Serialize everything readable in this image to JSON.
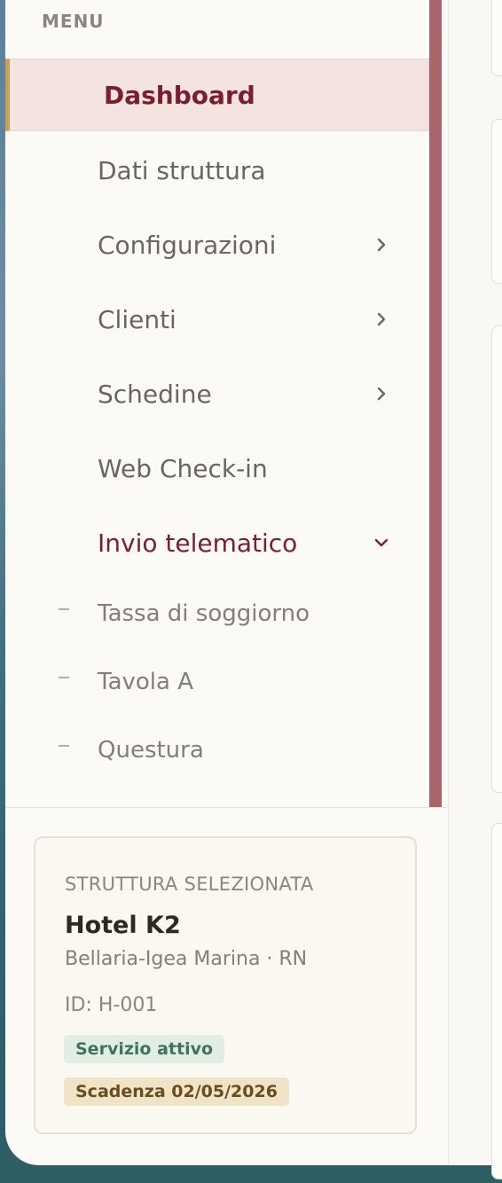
{
  "menu": {
    "heading": "MENU",
    "items": [
      {
        "label": "Dashboard",
        "active": true,
        "chevron": null
      },
      {
        "label": "Dati struttura",
        "chevron": null
      },
      {
        "label": "Configurazioni",
        "chevron": "chevron-right-icon"
      },
      {
        "label": "Clienti",
        "chevron": "chevron-right-icon"
      },
      {
        "label": "Schedine",
        "chevron": "chevron-right-icon"
      },
      {
        "label": "Web Check-in",
        "chevron": null
      },
      {
        "label": "Invio telematico",
        "open": true,
        "chevron": "chevron-down-icon"
      }
    ],
    "subitems": [
      {
        "label": "Tassa di soggiorno"
      },
      {
        "label": "Tavola A"
      },
      {
        "label": "Questura"
      }
    ]
  },
  "structure": {
    "heading": "STRUTTURA SELEZIONATA",
    "name": "Hotel K2",
    "place": "Bellaria-Igea Marina · RN",
    "id": "ID: H-001",
    "status_badge": "Servizio attivo",
    "expiry_badge": "Scadenza 02/05/2026"
  },
  "colors": {
    "accent": "#7a1f2b",
    "scrollbar": "#a8666b",
    "active_bg": "#f3e4e2",
    "active_border": "#c7a15c",
    "status_green": "#3d7558",
    "expiry_gold": "#6a4d1c"
  }
}
